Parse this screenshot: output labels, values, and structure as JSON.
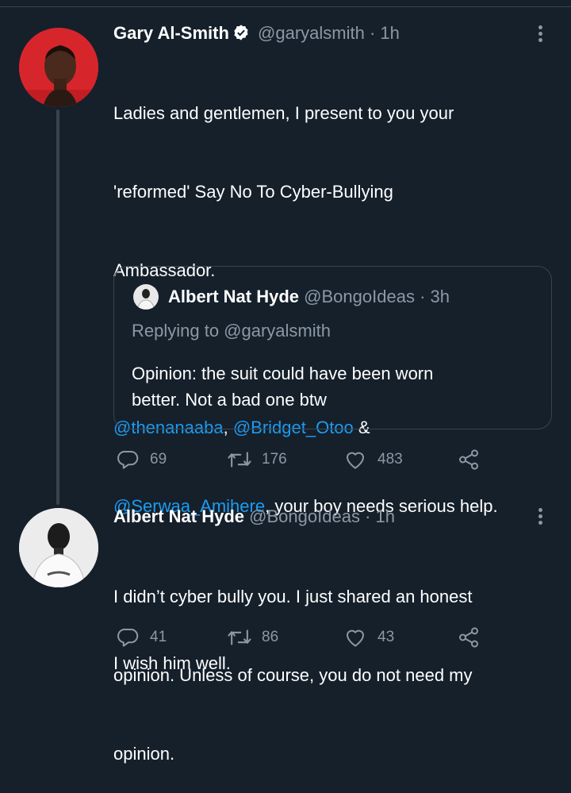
{
  "tweet1": {
    "name": "Gary Al-Smith",
    "handle": "@garyalsmith",
    "time": "· 1h",
    "text_line1": "Ladies and gentlemen, I present to you your",
    "text_line2": "'reformed' Say No To Cyber-Bullying",
    "text_line3": "Ambassador.",
    "mention1": "@thenanaaba",
    "sep1": ", ",
    "mention2": "@Bridget_Otoo",
    "sep2": " &",
    "mention3": "@Serwaa_Amihere",
    "after_mentions": ", your boy needs serious help.",
    "closing": "I wish him well.",
    "replies": "69",
    "retweets": "176",
    "likes": "483"
  },
  "quote": {
    "name": "Albert Nat Hyde",
    "handle": "@BongoIdeas",
    "time": "· 3h",
    "replying_to": "Replying to @garyalsmith",
    "text_line1": "Opinion: the suit could have been worn",
    "text_line2": "better. Not a bad one btw"
  },
  "tweet2": {
    "name": "Albert Nat Hyde",
    "handle": "@BongoIdeas",
    "time": "· 1h",
    "text_line1": "I didn’t cyber bully you. I just shared an honest",
    "text_line2": "opinion. Unless of course, you do not need my",
    "text_line3": "opinion.",
    "replies": "41",
    "retweets": "86",
    "likes": "43"
  },
  "colors": {
    "background": "#15202b",
    "link": "#1d9bf0",
    "muted": "#8b98a5",
    "border": "#38444d"
  }
}
